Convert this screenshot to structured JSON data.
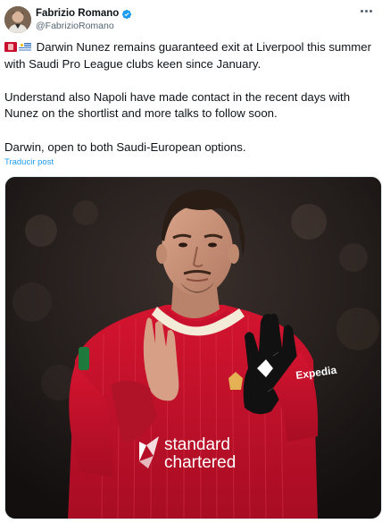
{
  "author": {
    "display_name": "Fabrizio Romano",
    "handle": "@FabrizioRomano",
    "verified": true,
    "verified_color": "#1d9bf0"
  },
  "menu_icon": "more-horizontal-icon",
  "tweet": {
    "line1_flags": [
      "red-white-badge-emoji",
      "uruguay-flag-emoji"
    ],
    "paragraph1": "Darwin Nunez remains guaranteed exit at Liverpool this summer with Saudi Pro League clubs keen since January.",
    "paragraph2": "Understand also Napoli have made contact in the recent days with Nunez on the shortlist and more talks to follow soon.",
    "paragraph3": "Darwin, open to both Saudi-European options."
  },
  "translate_link": "Traducir post",
  "media": {
    "kind": "photo",
    "sponsor_text_line1": "standard",
    "sponsor_text_line2": "chartered",
    "sleeve_sponsor": "Expedia",
    "colors": {
      "kit_red": "#c8102e",
      "background": "#1b1716"
    }
  },
  "colors": {
    "text": "#0f1419",
    "secondary": "#536471",
    "link": "#1d9bf0"
  }
}
